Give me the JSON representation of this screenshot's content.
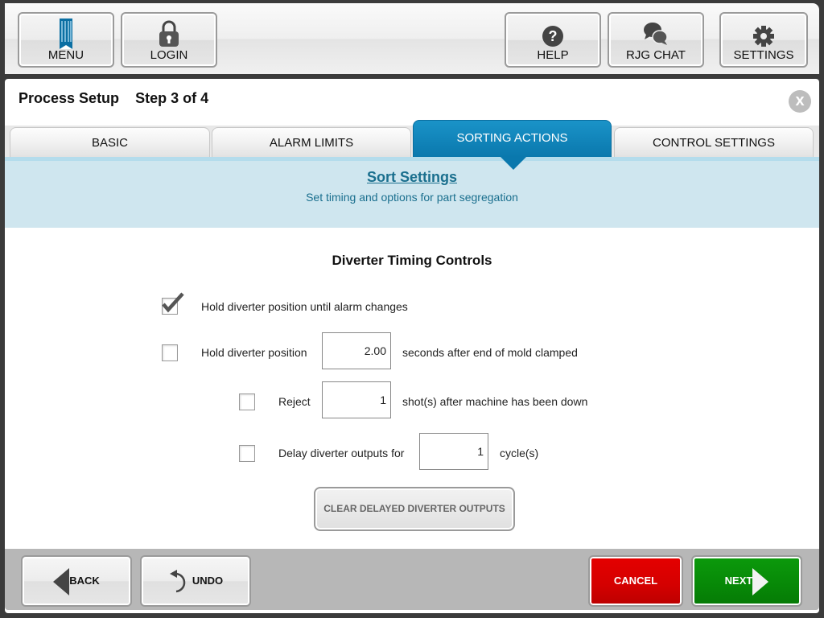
{
  "topbar": {
    "menu": {
      "label": "MENU",
      "icon": "rjg-logo-icon"
    },
    "login": {
      "label": "LOGIN",
      "icon": "lock-icon"
    },
    "help": {
      "label": "HELP",
      "icon": "question-icon"
    },
    "chat": {
      "label": "RJG CHAT",
      "icon": "chat-icon"
    },
    "settings": {
      "label": "SETTINGS",
      "icon": "gear-icon"
    }
  },
  "header": {
    "title": "Process Setup",
    "step": "Step 3 of 4",
    "close_label": "x"
  },
  "tabs": [
    {
      "label": "BASIC",
      "active": false
    },
    {
      "label": "ALARM LIMITS",
      "active": false
    },
    {
      "label": "SORTING ACTIONS",
      "active": true
    },
    {
      "label": "CONTROL SETTINGS",
      "active": false
    }
  ],
  "section": {
    "title": "Sort Settings",
    "subtitle": "Set timing and options for part segregation"
  },
  "content": {
    "heading": "Diverter Timing Controls",
    "rows": [
      {
        "checked": true,
        "label": "Hold diverter position until alarm changes"
      },
      {
        "checked": false,
        "label": "Hold diverter position",
        "value": "2.00",
        "suffix": "seconds after end of mold clamped"
      },
      {
        "checked": false,
        "label": "Reject",
        "value": "1",
        "suffix": "shot(s) after machine has been down"
      },
      {
        "checked": false,
        "label": "Delay diverter outputs for",
        "value": "1",
        "suffix": "cycle(s)"
      }
    ],
    "clear_button": "CLEAR DELAYED DIVERTER OUTPUTS"
  },
  "footer": {
    "back": "BACK",
    "undo": "UNDO",
    "cancel": "CANCEL",
    "next": "NEXT"
  },
  "colors": {
    "accent": "#0a78ad",
    "band": "#cfe6ef",
    "cancel": "#d40000",
    "next": "#078807"
  }
}
